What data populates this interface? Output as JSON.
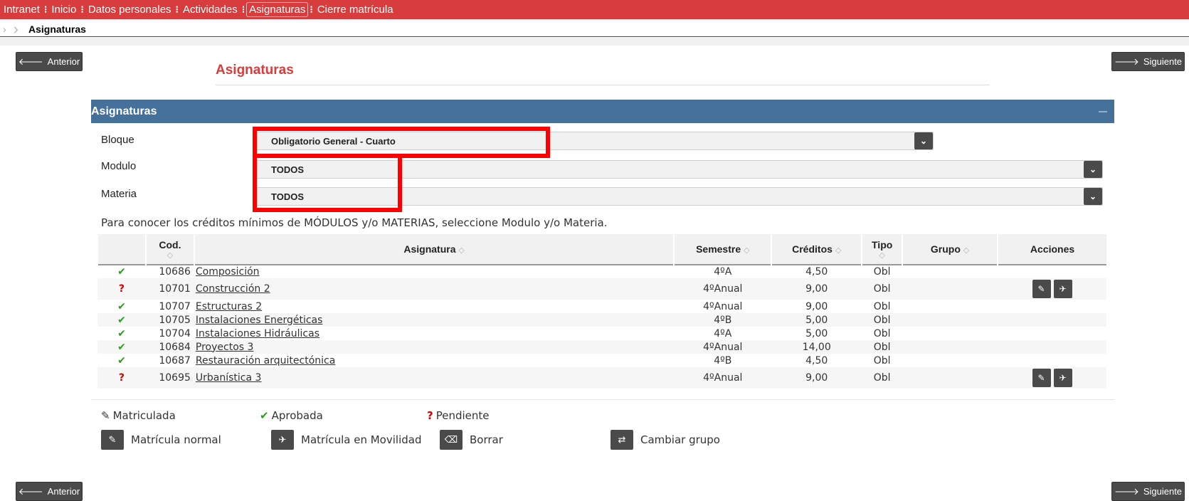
{
  "nav": {
    "items": [
      "Intranet",
      "Inicio",
      "Datos personales",
      "Actividades",
      "Asignaturas",
      "Cierre matrícula"
    ],
    "separator": "⁝",
    "active_index": 4
  },
  "breadcrumb": {
    "current": "Asignaturas"
  },
  "buttons": {
    "prev": "Anterior",
    "next": "Siguiente",
    "prev_icon": "arrow-left-icon",
    "next_icon": "arrow-right-icon"
  },
  "page_title": "Asignaturas",
  "panel": {
    "title": "Asignaturas"
  },
  "filters": {
    "bloque": {
      "label": "Bloque",
      "value": "Obligatorio General - Cuarto"
    },
    "modulo": {
      "label": "Modulo",
      "value": "TODOS"
    },
    "materia": {
      "label": "Materia",
      "value": "TODOS"
    }
  },
  "info_text": "Para conocer los créditos mínimos de MÓDULOS y/o MATERIAS, seleccione Modulo y/o Materia.",
  "table": {
    "headers": {
      "cod": "Cod.",
      "asignatura": "Asignatura",
      "semestre": "Semestre",
      "creditos": "Créditos",
      "tipo": "Tipo",
      "grupo": "Grupo",
      "acciones": "Acciones"
    },
    "sort_glyph": "◇",
    "rows": [
      {
        "status": "ok",
        "status_glyph": "✔",
        "cod": "10686",
        "asignatura": "Composición",
        "semestre": "4ºA",
        "creditos": "4,50",
        "tipo": "Obl",
        "grupo": "",
        "actions": false
      },
      {
        "status": "pend",
        "status_glyph": "?",
        "cod": "10701",
        "asignatura": "Construcción 2",
        "semestre": "4ºAnual",
        "creditos": "9,00",
        "tipo": "Obl",
        "grupo": "",
        "actions": true
      },
      {
        "status": "ok",
        "status_glyph": "✔",
        "cod": "10707",
        "asignatura": "Estructuras 2",
        "semestre": "4ºAnual",
        "creditos": "9,00",
        "tipo": "Obl",
        "grupo": "",
        "actions": false
      },
      {
        "status": "ok",
        "status_glyph": "✔",
        "cod": "10705",
        "asignatura": "Instalaciones Energéticas",
        "semestre": "4ºB",
        "creditos": "5,00",
        "tipo": "Obl",
        "grupo": "",
        "actions": false
      },
      {
        "status": "ok",
        "status_glyph": "✔",
        "cod": "10704",
        "asignatura": "Instalaciones Hidráulicas",
        "semestre": "4ºA",
        "creditos": "5,00",
        "tipo": "Obl",
        "grupo": "",
        "actions": false
      },
      {
        "status": "ok",
        "status_glyph": "✔",
        "cod": "10684",
        "asignatura": "Proyectos 3",
        "semestre": "4ºAnual",
        "creditos": "14,00",
        "tipo": "Obl",
        "grupo": "",
        "actions": false
      },
      {
        "status": "ok",
        "status_glyph": "✔",
        "cod": "10687",
        "asignatura": "Restauración arquitectónica",
        "semestre": "4ºB",
        "creditos": "4,50",
        "tipo": "Obl",
        "grupo": "",
        "actions": false
      },
      {
        "status": "pend",
        "status_glyph": "?",
        "cod": "10695",
        "asignatura": "Urbanística 3",
        "semestre": "4ºAnual",
        "creditos": "9,00",
        "tipo": "Obl",
        "grupo": "",
        "actions": true
      }
    ],
    "row_actions": [
      {
        "icon": "pencil-icon",
        "glyph": "✎"
      },
      {
        "icon": "plane-icon",
        "glyph": "✈"
      }
    ]
  },
  "legend": {
    "matriculada": "Matriculada",
    "aprobada": "Aprobada",
    "pendiente": "Pendiente",
    "matricula_normal": "Matrícula normal",
    "matricula_movilidad": "Matrícula en Movilidad",
    "borrar": "Borrar",
    "cambiar_grupo": "Cambiar grupo"
  },
  "colors": {
    "brand_red": "#d83c3c",
    "panel_blue": "#44709a",
    "approved_green": "#2aa01e",
    "pending_red": "#d40000",
    "highlight_red": "#ff0000",
    "button_dark": "#4a4a4a"
  }
}
